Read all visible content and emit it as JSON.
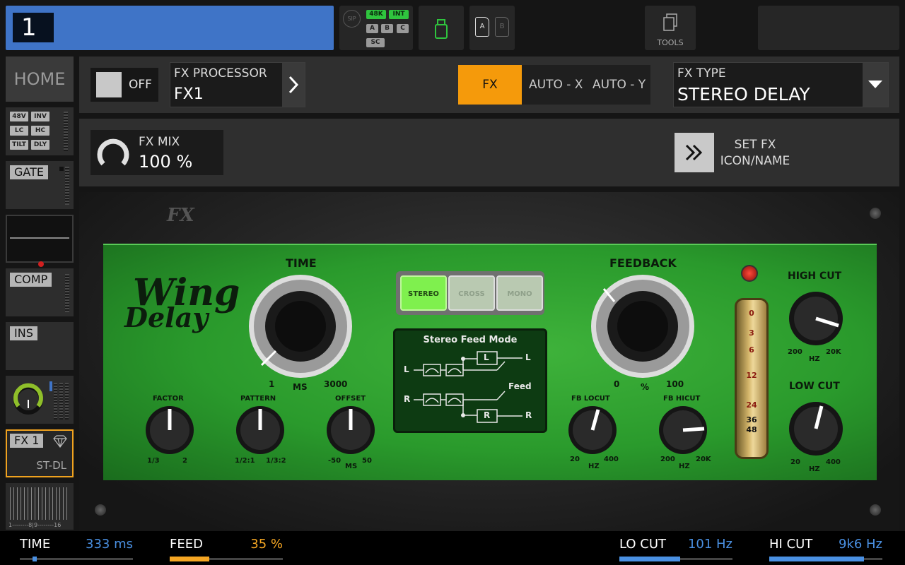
{
  "channel": {
    "number": "1"
  },
  "status": {
    "sip": "SIP",
    "rate": "48K",
    "clock": "INT",
    "slots": [
      "A",
      "B",
      "C"
    ],
    "sc": "SC",
    "cards": [
      "A",
      "B"
    ],
    "tools_label": "TOOLS"
  },
  "sidebar": {
    "home": "HOME",
    "filters": [
      "48V",
      "INV",
      "LC",
      "HC",
      "TILT",
      "DLY"
    ],
    "gate": "GATE",
    "comp": "COMP",
    "ins": "INS",
    "fx_slot": "FX 1",
    "fx_sub": "ST-DL",
    "meter_scale": "1--------8|9--------16"
  },
  "header": {
    "on_label": "OFF",
    "processor_label": "FX PROCESSOR",
    "processor_value": "FX1",
    "modes": {
      "fx": "FX",
      "auto_x": "AUTO - X",
      "auto_y": "AUTO - Y"
    },
    "fx_type_label": "FX TYPE",
    "fx_type_value": "STEREO DELAY"
  },
  "row2": {
    "mix_label": "FX MIX",
    "mix_value": "100 %",
    "set_fx_line1": "SET FX",
    "set_fx_line2": "ICON/NAME"
  },
  "plugin": {
    "logo": "FX",
    "brand_line1": "Wing",
    "brand_line2": "Delay",
    "time": {
      "label": "TIME",
      "min": "1",
      "unit": "MS",
      "max": "3000"
    },
    "factor": {
      "label": "FACTOR",
      "min": "1/3",
      "max": "2"
    },
    "pattern": {
      "label": "PATTERN",
      "min": "1/2:1",
      "max": "1/3:2"
    },
    "offset": {
      "label": "OFFSET",
      "min": "-50",
      "unit": "MS",
      "max": "50"
    },
    "modes": [
      "STEREO",
      "CROSS",
      "MONO"
    ],
    "active_mode": "STEREO",
    "scope_title": "Stereo Feed Mode",
    "scope_labels": {
      "l": "L",
      "r": "R",
      "feed": "Feed"
    },
    "feedback": {
      "label": "FEEDBACK",
      "min": "0",
      "unit": "%",
      "max": "100"
    },
    "fb_locut": {
      "label": "FB LOCUT",
      "min": "20",
      "unit": "HZ",
      "max": "400"
    },
    "fb_hicut": {
      "label": "FB HICUT",
      "min": "200",
      "unit": "HZ",
      "max": "20K"
    },
    "vu_scale": [
      "0",
      "3",
      "6",
      "12",
      "24",
      "36",
      "48"
    ],
    "high_cut": {
      "label": "HIGH CUT",
      "min": "200",
      "unit": "HZ",
      "max": "20K"
    },
    "low_cut": {
      "label": "LOW CUT",
      "min": "20",
      "unit": "HZ",
      "max": "400"
    }
  },
  "bottom": {
    "params": [
      {
        "label": "TIME",
        "value": "333 ms",
        "color": "#4a90e2",
        "fill": 0.11
      },
      {
        "label": "FEED",
        "value": "35 %",
        "color": "#f5a623",
        "fill": 0.35
      },
      {
        "label": "LO CUT",
        "value": "101 Hz",
        "color": "#4a90e2",
        "fill": 0.54
      },
      {
        "label": "HI CUT",
        "value": "9k6 Hz",
        "color": "#4a90e2",
        "fill": 0.84
      }
    ]
  },
  "colors": {
    "accent": "#f59a0b",
    "channel": "#3f74c7",
    "plugin_green": "#2a9a2c"
  }
}
